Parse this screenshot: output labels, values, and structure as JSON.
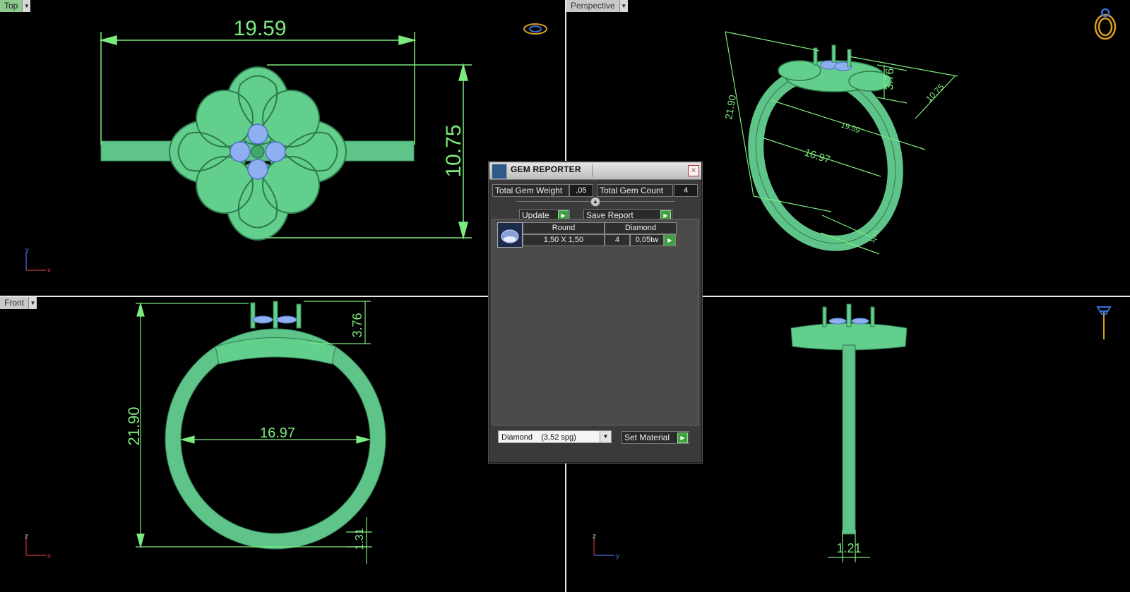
{
  "viewports": {
    "top": {
      "label": "Top"
    },
    "perspective": {
      "label": "Perspective"
    },
    "front": {
      "label": "Front"
    }
  },
  "dimensions": {
    "top_width": "19.59",
    "top_height": "10.75",
    "persp_height": "21.90",
    "persp_top": "3.76",
    "persp_width": "10.75",
    "persp_len": "19.59",
    "persp_inner": "16.97",
    "persp_band": "1.31",
    "front_height": "21.90",
    "front_top": "3.76",
    "front_inner": "16.97",
    "front_band": "1.31",
    "side_band": "1.21"
  },
  "axes": {
    "top": {
      "v": "y",
      "h": "x"
    },
    "front": {
      "v": "z",
      "h": "x"
    },
    "right": {
      "v": "z",
      "h": "y"
    }
  },
  "gem_reporter": {
    "title": "GEM REPORTER",
    "close": "×",
    "total_weight_label": "Total Gem Weight",
    "total_weight_value": ",05",
    "total_count_label": "Total Gem Count",
    "total_count_value": "4",
    "update_label": "Update",
    "save_report_label": "Save Report",
    "row": {
      "shape": "Round",
      "type": "Diamond",
      "size": "1,50 X 1,50",
      "count": "4",
      "weight": "0,05tw"
    },
    "material_select": "Diamond    (3,52 spg)",
    "set_material_label": "Set Material"
  },
  "colors": {
    "model": "#6fd79b",
    "dimension": "#7dea7d",
    "gem": "#8fb0f0"
  }
}
